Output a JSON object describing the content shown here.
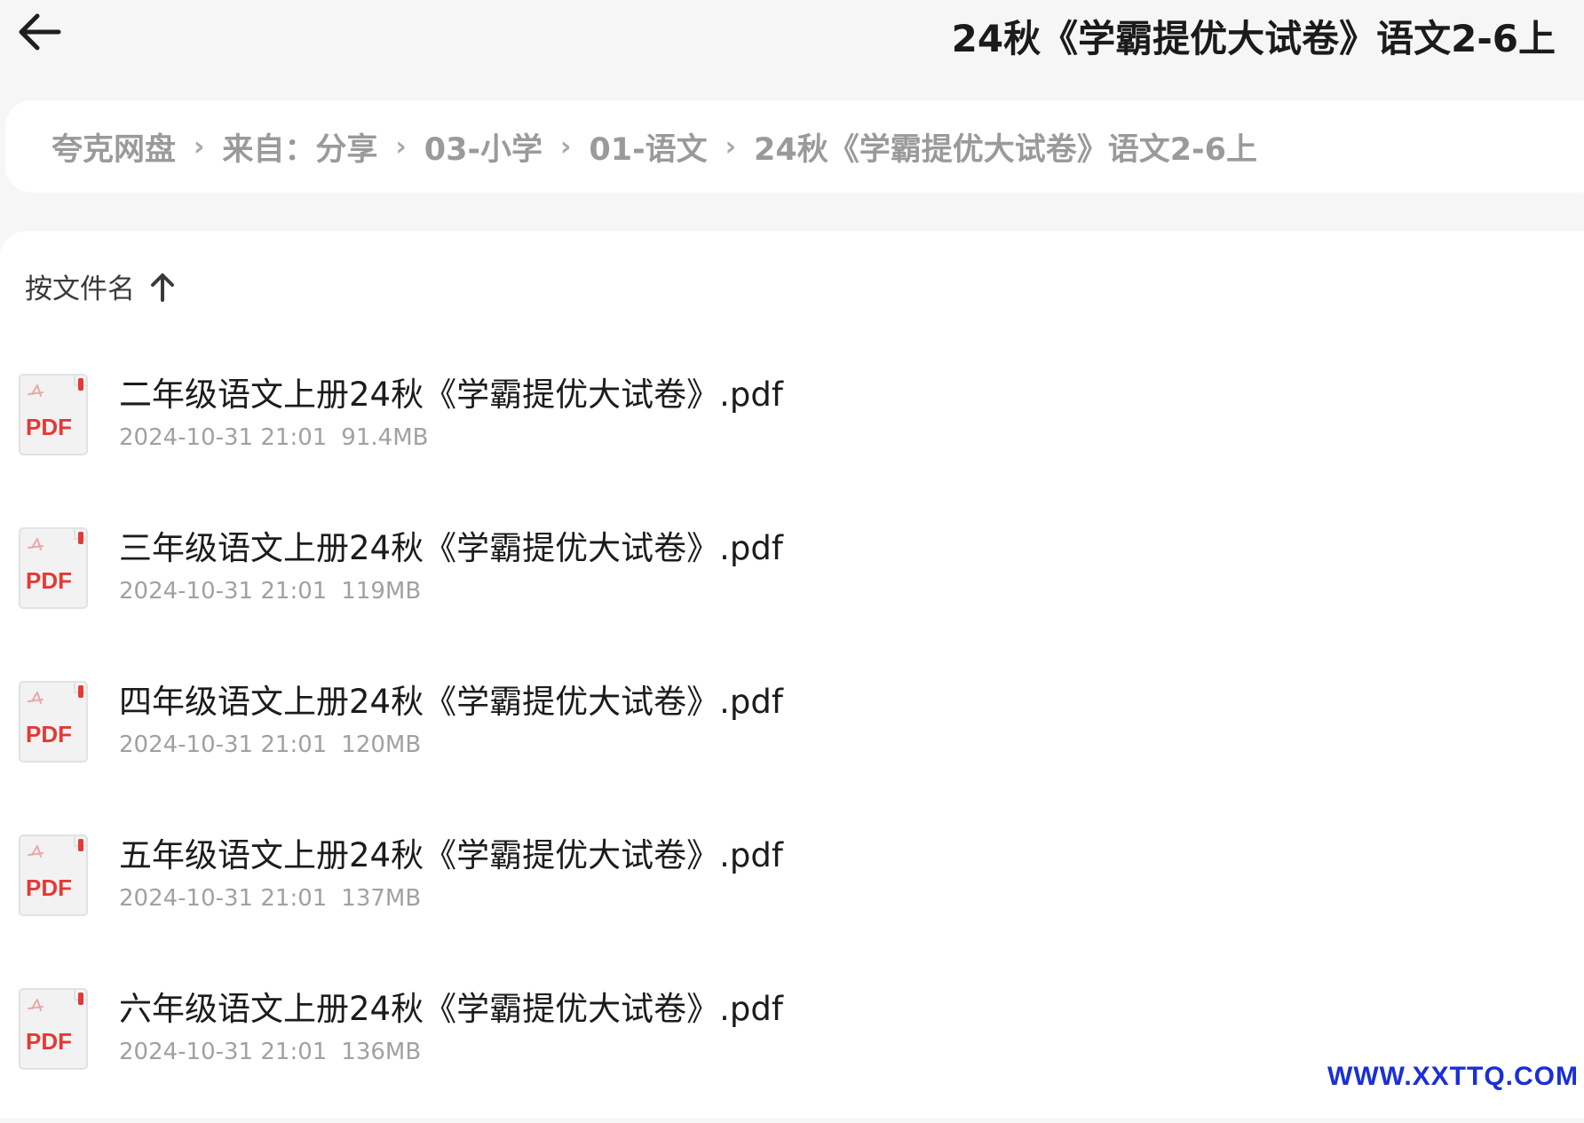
{
  "header": {
    "title": "24秋《学霸提优大试卷》语文2-6上",
    "back_icon": "arrow-left-icon"
  },
  "breadcrumb": {
    "separator": "›",
    "items": [
      {
        "label": "夸克网盘"
      },
      {
        "label": "来自：分享"
      },
      {
        "label": "03-小学"
      },
      {
        "label": "01-语文"
      },
      {
        "label": "24秋《学霸提优大试卷》语文2-6上"
      }
    ]
  },
  "sort": {
    "label": "按文件名",
    "direction_icon": "arrow-up-icon"
  },
  "file_icon": {
    "label": "PDF",
    "accent_color": "#e23a36"
  },
  "files": [
    {
      "name": "二年级语文上册24秋《学霸提优大试卷》.pdf",
      "date": "2024-10-31 21:01",
      "size": "91.4MB"
    },
    {
      "name": "三年级语文上册24秋《学霸提优大试卷》.pdf",
      "date": "2024-10-31 21:01",
      "size": "119MB"
    },
    {
      "name": "四年级语文上册24秋《学霸提优大试卷》.pdf",
      "date": "2024-10-31 21:01",
      "size": "120MB"
    },
    {
      "name": "五年级语文上册24秋《学霸提优大试卷》.pdf",
      "date": "2024-10-31 21:01",
      "size": "137MB"
    },
    {
      "name": "六年级语文上册24秋《学霸提优大试卷》.pdf",
      "date": "2024-10-31 21:01",
      "size": "136MB"
    }
  ],
  "watermark": "WWW.XXTTQ.COM"
}
